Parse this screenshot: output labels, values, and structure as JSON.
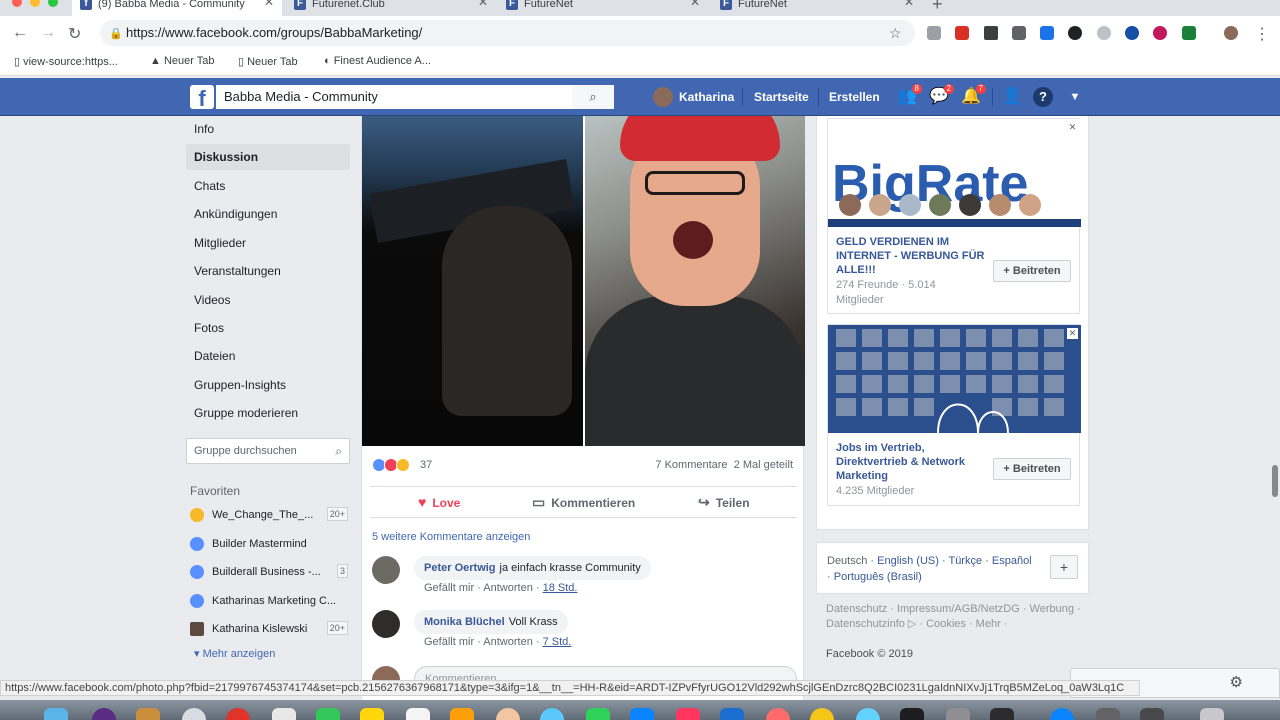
{
  "browser": {
    "tabs": [
      {
        "label": "(9) Babba Media - Community",
        "active": true
      },
      {
        "label": "Futurenet.Club",
        "active": false
      },
      {
        "label": "FutureNet",
        "active": false
      },
      {
        "label": "FutureNet",
        "active": false
      }
    ],
    "url": "https://www.facebook.com/groups/BabbaMarketing/",
    "bookmarks": [
      "view-source:https...",
      "Neuer Tab",
      "Neuer Tab",
      "Finest Audience A..."
    ],
    "status_url": "https://www.facebook.com/photo.php?fbid=2179976745374174&set=pcb.2156276367968171&type=3&ifg=1&__tn__=HH-R&eid=ARDT-IZPvFfyrUGO12Vld292whScjlGEnDzrc8Q2BCI0231LgaIdnNIXvJj1TrqB5MZeLoq_0aW3Lq1C"
  },
  "fb_header": {
    "logo": "f",
    "search_value": "Babba Media - Community",
    "user_name": "Katharina",
    "nav": [
      "Startseite",
      "Erstellen"
    ],
    "badges": {
      "friends": "8",
      "messages": "2",
      "notifications": "7"
    }
  },
  "left_nav": {
    "items": [
      {
        "label": "Info",
        "active": false
      },
      {
        "label": "Diskussion",
        "active": true
      },
      {
        "label": "Chats",
        "active": false
      },
      {
        "label": "Ankündigungen",
        "active": false
      },
      {
        "label": "Mitglieder",
        "active": false
      },
      {
        "label": "Veranstaltungen",
        "active": false
      },
      {
        "label": "Videos",
        "active": false
      },
      {
        "label": "Fotos",
        "active": false
      },
      {
        "label": "Dateien",
        "active": false
      },
      {
        "label": "Gruppen-Insights",
        "active": false
      },
      {
        "label": "Gruppe moderieren",
        "active": false
      }
    ],
    "group_search_placeholder": "Gruppe durchsuchen",
    "favorites_heading": "Favoriten",
    "favorites": [
      {
        "label": "We_Change_The_...",
        "count": "20+"
      },
      {
        "label": "Builder Mastermind",
        "count": ""
      },
      {
        "label": "Builderall Business -...",
        "count": "3"
      },
      {
        "label": "Katharinas Marketing C...",
        "count": "20+"
      },
      {
        "label": "Katharina Kislewski",
        "count": "20+"
      }
    ],
    "more_label": "Mehr anzeigen"
  },
  "post": {
    "reaction_count": "37",
    "comments_count": "7 Kommentare",
    "shares_count": "2 Mal geteilt",
    "actions": {
      "love": "Love",
      "comment": "Kommentieren",
      "share": "Teilen"
    },
    "more_comments": "5 weitere Kommentare anzeigen",
    "comments": [
      {
        "name": "Peter Oertwig",
        "text": "ja einfach krasse Community",
        "like": "Gefällt mir",
        "reply": "Antworten",
        "time": "18 Std."
      },
      {
        "name": "Monika Blüchel",
        "text": "Voll Krass",
        "like": "Gefällt mir",
        "reply": "Antworten",
        "time": "7 Std."
      }
    ],
    "comment_placeholder": "Kommentieren ..."
  },
  "right_col": {
    "ads": [
      {
        "title": "GELD VERDIENEN IM INTERNET - WERBUNG FÜR ALLE!!!",
        "sub": "274 Freunde · 5.014 Mitglieder",
        "join": "+ Beitreten"
      },
      {
        "title": "Jobs im Vertrieb, Direktvertrieb & Network Marketing",
        "sub": "4.235 Mitglieder",
        "join": "+ Beitreten"
      }
    ],
    "ad1_image_text": "BigRate",
    "languages": {
      "current": "Deutsch",
      "others": [
        "English (US)",
        "Türkçe",
        "Español",
        "Português (Brasil)"
      ]
    },
    "footer": "Datenschutz · Impressum/AGB/NetzDG · Werbung · Datenschutzinfo ▷ · Cookies · Mehr ·",
    "copyright": "Facebook © 2019"
  },
  "colors": {
    "fb_blue": "#4267b2",
    "love": "#f33e58",
    "link": "#385898"
  }
}
